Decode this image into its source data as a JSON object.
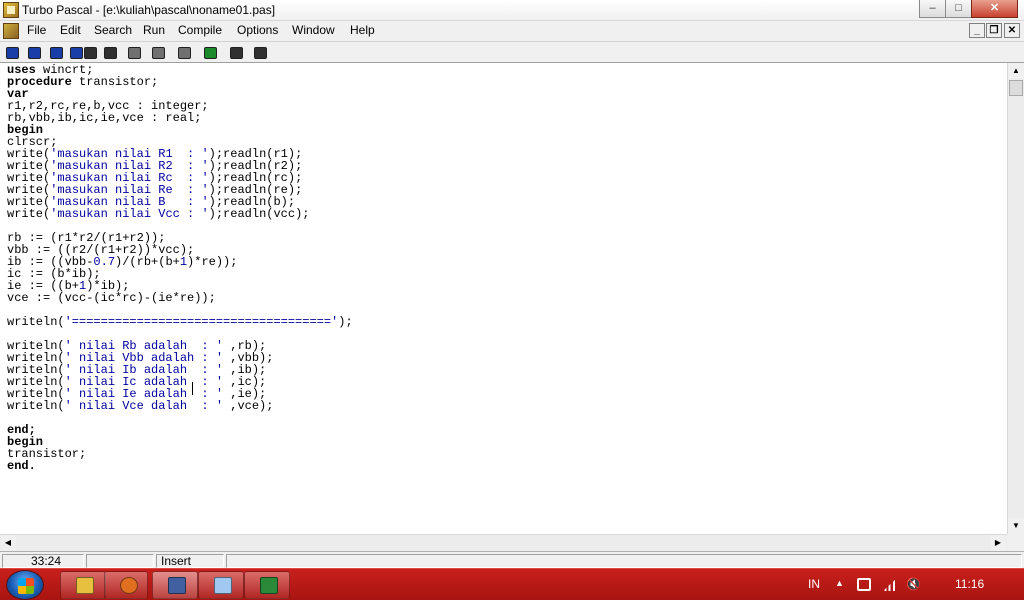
{
  "window": {
    "title": "Turbo Pascal - [e:\\kuliah\\pascal\\noname01.pas]",
    "controls": {
      "minimize": "–",
      "maximize": "□",
      "close": "✕"
    }
  },
  "menu": {
    "items": [
      "File",
      "Edit",
      "Search",
      "Run",
      "Compile",
      "Options",
      "Window",
      "Help"
    ],
    "mdi_controls": {
      "minimize": "_",
      "restore": "❐",
      "close": "✕"
    }
  },
  "toolbar": {
    "buttons": [
      {
        "icon": "help-icon",
        "color": "#1a3ea8"
      },
      {
        "icon": "open-file-icon",
        "color": "#1a3ea8"
      },
      {
        "icon": "save-icon",
        "color": "#1a3ea8"
      },
      {
        "icon": "save-all-icon",
        "color": "#1a3ea8"
      },
      {
        "icon": "find-icon",
        "color": "#303030"
      },
      {
        "icon": "find-again-icon",
        "color": "#303030"
      },
      {
        "icon": "run-icon",
        "color": "#707070"
      },
      {
        "icon": "step-over-icon",
        "color": "#707070"
      },
      {
        "icon": "trace-into-icon",
        "color": "#707070"
      },
      {
        "icon": "undo-icon",
        "color": "#1a8a2a"
      },
      {
        "icon": "compile-icon",
        "color": "#303030"
      },
      {
        "icon": "make-icon",
        "color": "#303030"
      }
    ]
  },
  "editor": {
    "lines": [
      [
        [
          "kw",
          "uses"
        ],
        [
          "",
          " wincrt;"
        ]
      ],
      [
        [
          "kw",
          "procedure"
        ],
        [
          "",
          " transistor;"
        ]
      ],
      [
        [
          "kw",
          "var"
        ]
      ],
      [
        [
          "",
          "r1,r2,rc,re,b,vcc : integer;"
        ]
      ],
      [
        [
          "",
          "rb,vbb,ib,ic,ie,vce : real;"
        ]
      ],
      [
        [
          "kw",
          "begin"
        ]
      ],
      [
        [
          "",
          "clrscr;"
        ]
      ],
      [
        [
          "",
          "write("
        ],
        [
          "str",
          "'masukan nilai R1  : '"
        ],
        [
          "",
          ");readln(r1);"
        ]
      ],
      [
        [
          "",
          "write("
        ],
        [
          "str",
          "'masukan nilai R2  : '"
        ],
        [
          "",
          ");readln(r2);"
        ]
      ],
      [
        [
          "",
          "write("
        ],
        [
          "str",
          "'masukan nilai Rc  : '"
        ],
        [
          "",
          ");readln(rc);"
        ]
      ],
      [
        [
          "",
          "write("
        ],
        [
          "str",
          "'masukan nilai Re  : '"
        ],
        [
          "",
          ");readln(re);"
        ]
      ],
      [
        [
          "",
          "write("
        ],
        [
          "str",
          "'masukan nilai B   : '"
        ],
        [
          "",
          ");readln(b);"
        ]
      ],
      [
        [
          "",
          "write("
        ],
        [
          "str",
          "'masukan nilai Vcc : '"
        ],
        [
          "",
          ");readln(vcc);"
        ]
      ],
      [],
      [
        [
          "",
          "rb := (r1*r2/(r1+r2));"
        ]
      ],
      [
        [
          "",
          "vbb := ((r2/(r1+r2))*vcc);"
        ]
      ],
      [
        [
          "",
          "ib := ((vbb-"
        ],
        [
          "str",
          "0.7"
        ],
        [
          "",
          ")/(rb+(b+"
        ],
        [
          "str",
          "1"
        ],
        [
          "",
          ")*re));"
        ]
      ],
      [
        [
          "",
          "ic := (b*ib);"
        ]
      ],
      [
        [
          "",
          "ie := ((b+"
        ],
        [
          "str",
          "1"
        ],
        [
          "",
          ")*ib);"
        ]
      ],
      [
        [
          "",
          "vce := (vcc-(ic*rc)-(ie*re));"
        ]
      ],
      [],
      [
        [
          "",
          "writeln("
        ],
        [
          "str",
          "'===================================='"
        ],
        [
          "",
          ");"
        ]
      ],
      [],
      [
        [
          "",
          "writeln("
        ],
        [
          "str",
          "' nilai Rb adalah  : '"
        ],
        [
          "",
          " ,rb);"
        ]
      ],
      [
        [
          "",
          "writeln("
        ],
        [
          "str",
          "' nilai Vbb adalah : '"
        ],
        [
          "",
          " ,vbb);"
        ]
      ],
      [
        [
          "",
          "writeln("
        ],
        [
          "str",
          "' nilai Ib adalah  : '"
        ],
        [
          "",
          " ,ib);"
        ]
      ],
      [
        [
          "",
          "writeln("
        ],
        [
          "str",
          "' nilai Ic adalah  : '"
        ],
        [
          "",
          " ,ic);"
        ]
      ],
      [
        [
          "",
          "writeln("
        ],
        [
          "str",
          "' nilai Ie adalah  : '"
        ],
        [
          "",
          " ,ie);"
        ]
      ],
      [
        [
          "",
          "writeln("
        ],
        [
          "str",
          "' nilai Vce dalah  : '"
        ],
        [
          "",
          " ,vce);"
        ]
      ],
      [],
      [
        [
          "kw",
          "end;"
        ]
      ],
      [
        [
          "kw",
          "begin"
        ]
      ],
      [
        [
          "",
          "transistor;"
        ]
      ],
      [
        [
          "kw",
          "end."
        ]
      ]
    ]
  },
  "scrollbars": {
    "up": "▲",
    "down": "▼",
    "left": "◀",
    "right": "▶"
  },
  "status": {
    "position": "33:24",
    "mode": "",
    "insert": "Insert"
  },
  "taskbar": {
    "buttons": [
      {
        "icon": "file-explorer-icon",
        "color": "#e8c040"
      },
      {
        "icon": "firefox-icon",
        "color": "#e07020"
      },
      {
        "icon": "turbo-pascal-icon",
        "color": "#4060a0",
        "active": true
      },
      {
        "icon": "notepad-icon",
        "color": "#a0c8f0"
      },
      {
        "icon": "excel-icon",
        "color": "#2a8a3a"
      }
    ],
    "tray": {
      "language": "IN",
      "time": "11:16"
    }
  }
}
